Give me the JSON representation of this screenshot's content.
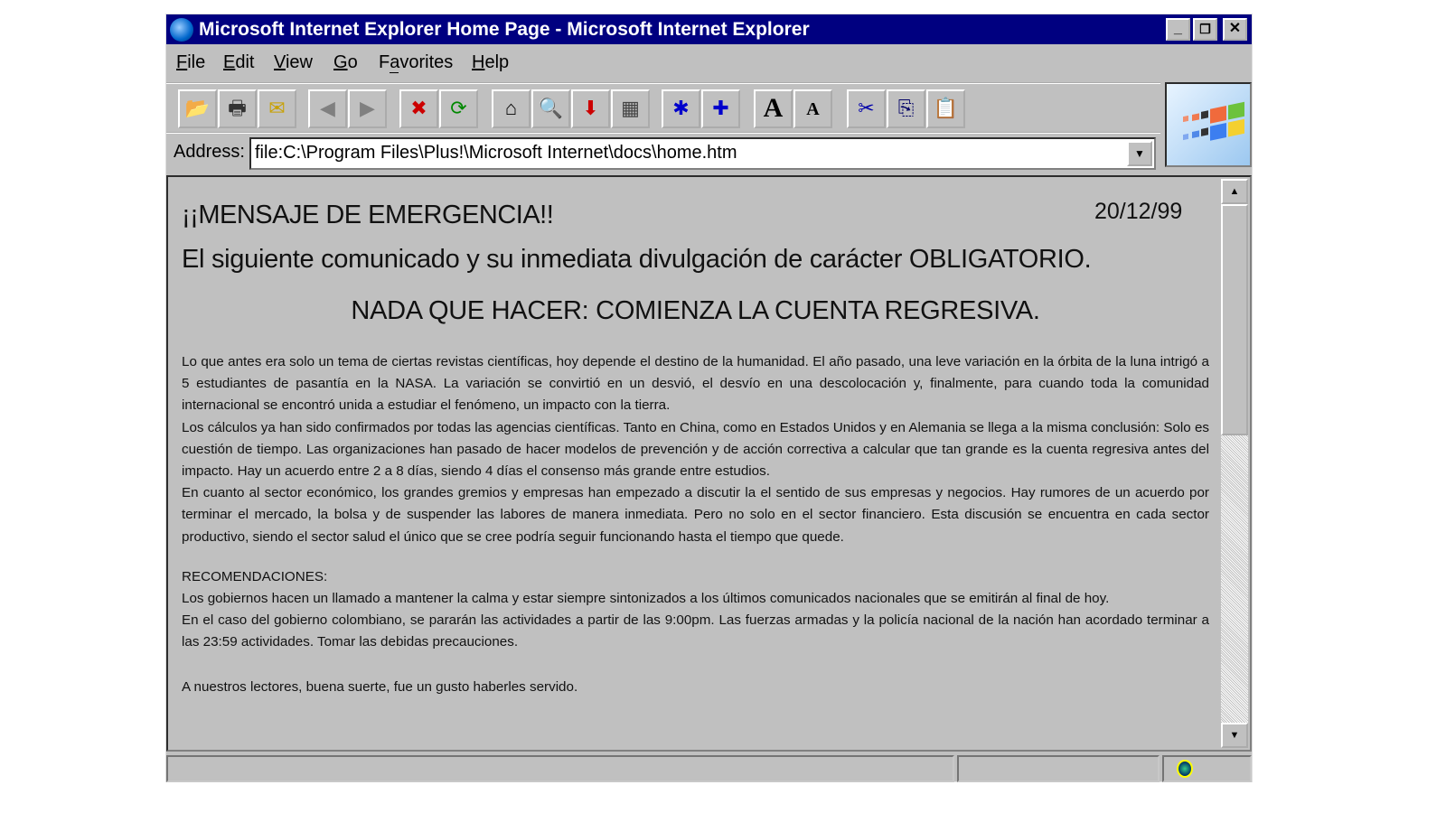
{
  "window": {
    "title": "Microsoft Internet Explorer Home Page - Microsoft Internet Explorer",
    "controls": [
      "minimize",
      "restore",
      "close"
    ]
  },
  "menu": [
    {
      "label": "File",
      "key": "F"
    },
    {
      "label": "Edit",
      "key": "E"
    },
    {
      "label": "View",
      "key": "V"
    },
    {
      "label": "Go",
      "key": "G"
    },
    {
      "label": "Favorites",
      "key": "a"
    },
    {
      "label": "Help",
      "key": "H"
    }
  ],
  "toolbar": [
    {
      "name": "open",
      "icon": "folder-open-icon",
      "glyph": "📂"
    },
    {
      "name": "print",
      "icon": "printer-icon",
      "glyph": "🖶"
    },
    {
      "name": "mail",
      "icon": "mail-icon",
      "glyph": "✉"
    },
    {
      "name": "back",
      "icon": "back-arrow-icon",
      "glyph": "◀"
    },
    {
      "name": "forward",
      "icon": "forward-arrow-icon",
      "glyph": "▶"
    },
    {
      "name": "stop",
      "icon": "stop-icon",
      "glyph": "✖"
    },
    {
      "name": "refresh",
      "icon": "refresh-icon",
      "glyph": "⟳"
    },
    {
      "name": "home",
      "icon": "home-icon",
      "glyph": "⌂"
    },
    {
      "name": "search",
      "icon": "search-globe-icon",
      "glyph": "🔍"
    },
    {
      "name": "download",
      "icon": "download-icon",
      "glyph": "⬇"
    },
    {
      "name": "news",
      "icon": "news-icon",
      "glyph": "▦"
    },
    {
      "name": "favorites",
      "icon": "favorites-folder-icon",
      "glyph": "✱"
    },
    {
      "name": "add-favorite",
      "icon": "add-favorite-icon",
      "glyph": "✚"
    },
    {
      "name": "larger-font",
      "icon": "font-larger-icon",
      "glyph": "A"
    },
    {
      "name": "smaller-font",
      "icon": "font-smaller-icon",
      "glyph": "A"
    },
    {
      "name": "cut",
      "icon": "scissors-icon",
      "glyph": "✂"
    },
    {
      "name": "copy",
      "icon": "copy-icon",
      "glyph": "⎘"
    },
    {
      "name": "paste",
      "icon": "paste-icon",
      "glyph": "📋"
    }
  ],
  "address": {
    "label": "Address:",
    "value": "file:C:\\Program Files\\Plus!\\Microsoft Internet\\docs\\home.htm"
  },
  "page": {
    "heading": "¡¡MENSAJE DE EMERGENCIA!!",
    "date": "20/12/99",
    "subheading": "El siguiente comunicado y su inmediata divulgación de carácter OBLIGATORIO.",
    "headline": "NADA QUE HACER: COMIENZA LA CUENTA REGRESIVA.",
    "paragraphs": [
      "Lo que antes era solo un tema de ciertas revistas científicas, hoy depende el destino de la humanidad. El año pasado, una leve variación en la órbita de la luna intrigó a 5 estudiantes de pasantía en la NASA. La variación se convirtió en un desvió, el desvío en una descolocación y, finalmente, para cuando toda la comunidad internacional se encontró unida a estudiar el fenómeno, un impacto con la tierra.",
      "Los cálculos ya han sido confirmados por todas las agencias científicas. Tanto en China, como en Estados Unidos y en Alemania se llega a la misma conclusión: Solo es cuestión de tiempo. Las organizaciones han pasado de hacer modelos de prevención y de acción correctiva a calcular que tan grande es la cuenta regresiva antes del impacto. Hay un acuerdo entre 2 a 8 días, siendo 4 días el consenso más grande entre estudios.",
      "En cuanto al sector económico, los grandes gremios y empresas han empezado a discutir la el sentido de sus empresas y negocios. Hay rumores de un acuerdo por terminar el mercado, la bolsa y de suspender las labores de manera inmediata. Pero no solo en el sector financiero. Esta discusión se encuentra en cada sector productivo, siendo el sector salud el único que se cree podría seguir funcionando hasta el tiempo que quede."
    ],
    "recommendations_title": "RECOMENDACIONES:",
    "recommendations": [
      "Los gobiernos hacen un llamado a mantener la calma y estar siempre sintonizados a los últimos comunicados nacionales que se emitirán al final de hoy.",
      "En el caso del gobierno colombiano, se pararán las actividades a partir de las 9:00pm. Las fuerzas armadas y la policía nacional de la nación han acordado terminar a las 23:59 actividades. Tomar las debidas precauciones."
    ],
    "closing": "A nuestros lectores, buena suerte, fue un gusto haberles servido."
  },
  "scroll": {
    "position_fraction": 0.0,
    "visible_fraction": 0.44
  }
}
